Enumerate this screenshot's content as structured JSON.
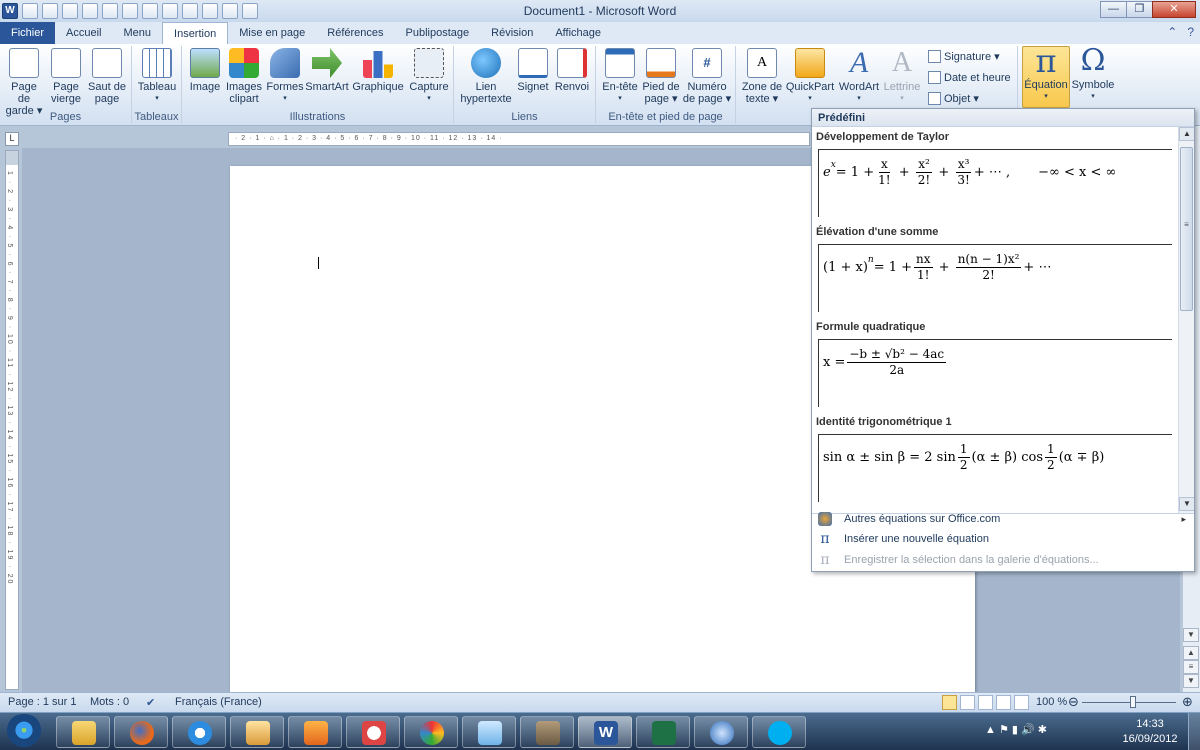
{
  "window": {
    "title": "Document1 - Microsoft Word",
    "app_icon": "W"
  },
  "quick_access": [
    "save-icon",
    "undo-icon",
    "redo-icon",
    "new-document-icon",
    "open-folder-icon",
    "print-icon",
    "print-preview-icon",
    "spelling-icon",
    "help-icon",
    "insert-picture-icon",
    "zoom-icon",
    "customize-icon"
  ],
  "window_controls": {
    "minimize": "—",
    "maximize": "❐",
    "close": "✕"
  },
  "tabs": [
    "Fichier",
    "Accueil",
    "Menu",
    "Insertion",
    "Mise en page",
    "Références",
    "Publipostage",
    "Révision",
    "Affichage"
  ],
  "active_tab": "Insertion",
  "ribbon": {
    "groups": {
      "pages": "Pages",
      "tableaux": "Tableaux",
      "illustrations": "Illustrations",
      "liens": "Liens",
      "entete": "En-tête et pied de page"
    },
    "buttons": {
      "page_garde": [
        "Page de",
        "garde ▾"
      ],
      "page_vierge": [
        "Page",
        "vierge"
      ],
      "saut_page": [
        "Saut de",
        "page"
      ],
      "tableau": [
        "Tableau",
        "▾"
      ],
      "image": "Image",
      "images_clipart": [
        "Images",
        "clipart"
      ],
      "formes": [
        "Formes",
        "▾"
      ],
      "smartart": "SmartArt",
      "graphique": "Graphique",
      "capture": [
        "Capture",
        "▾"
      ],
      "lien": [
        "Lien",
        "hypertexte"
      ],
      "signet": "Signet",
      "renvoi": "Renvoi",
      "entete": [
        "En-tête",
        "▾"
      ],
      "pied_page": [
        "Pied de",
        "page ▾"
      ],
      "numero_page": [
        "Numéro",
        "de page ▾"
      ],
      "zone_texte": [
        "Zone de",
        "texte ▾"
      ],
      "quickpart": [
        "QuickPart",
        "▾"
      ],
      "wordart": [
        "WordArt",
        "▾"
      ],
      "lettrine": [
        "Lettrine",
        "▾"
      ],
      "signature": "Signature ▾",
      "date_heure": "Date et heure",
      "objet": "Objet ▾",
      "equation": [
        "Équation",
        "▾"
      ],
      "symbole": [
        "Symbole",
        "▾"
      ]
    },
    "icon_glyphs": {
      "numero": "#",
      "zone_texte": "A",
      "wordart": "A",
      "lettrine": "A",
      "pi": "π",
      "omega": "Ω"
    }
  },
  "ruler": {
    "horizontal_marks": "· 2 · 1 · ⌂ · 1 · 2 · 3 · 4 · 5 · 6 · 7 · 8 · 9 · 10 · 11 · 12 · 13 · 14 ·",
    "corner": "L",
    "vertical_marks": "1 · 2 · 3 · 4 · 5 · 6 · 7 · 8 · 9 · 10 · 11 · 12 · 13 · 14 · 15 · 16 · 17 · 18 · 19 · 20"
  },
  "gallery": {
    "header": "Prédéfini",
    "items": [
      {
        "title": "Développement de Taylor"
      },
      {
        "title": "Élévation d'une somme"
      },
      {
        "title": "Formule quadratique"
      },
      {
        "title": "Identité trigonométrique 1"
      }
    ],
    "eq_text": {
      "taylor_lhs": "e",
      "taylor_exp": "x",
      "taylor_eq": " = 1 + ",
      "f1n": "x",
      "f1d": "1!",
      "f2n": "x²",
      "f2d": "2!",
      "f3n": "x³",
      "f3d": "3!",
      "taylor_tail": " + ⋯ ,",
      "taylor_range": "−∞ < x < ∞",
      "binom_lhs": "(1 + x)",
      "binom_exp": "n",
      "binom_eq": " = 1 + ",
      "b1n": "nx",
      "b1d": "1!",
      "b2n": "n(n − 1)x²",
      "b2d": "2!",
      "binom_tail": " + ⋯",
      "quad_lhs": "x = ",
      "quad_n": "−b ± √b² − 4ac",
      "quad_d": "2a",
      "trig_a": "sin α ± sin β = 2 sin",
      "half_n": "1",
      "half_d": "2",
      "trig_b": "(α ± β) cos",
      "trig_c": "(α ∓ β)"
    },
    "scroll": {
      "up": "▲",
      "mid": "≡",
      "down": "▼"
    },
    "menu": [
      {
        "label": "Autres équations sur Office.com",
        "arrow": "▸"
      },
      {
        "label": "Insérer une nouvelle équation",
        "icon": "π"
      },
      {
        "label": "Enregistrer la sélection dans la galerie d'équations...",
        "icon": "π"
      }
    ]
  },
  "statusbar": {
    "page": "Page : 1 sur 1",
    "words": "Mots : 0",
    "language": "Français (France)",
    "zoom": "100 %",
    "minus": "⊖",
    "plus": "⊕"
  },
  "taskbar": {
    "clock_time": "14:33",
    "clock_date": "16/09/2012",
    "tray": "▲  ⚑  ▮  🔊  ✱"
  }
}
